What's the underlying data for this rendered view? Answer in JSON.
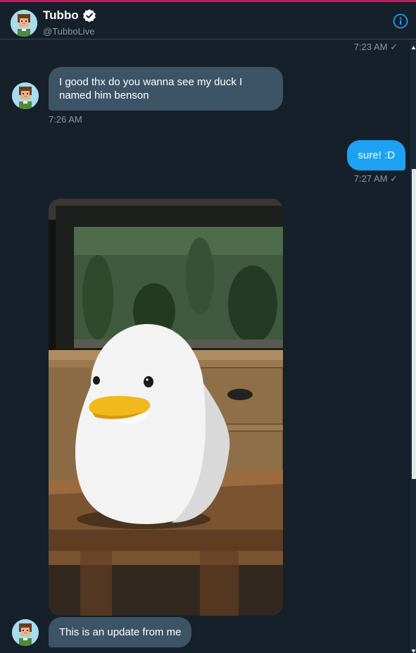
{
  "header": {
    "name": "Tubbo",
    "handle": "@TubboLive"
  },
  "messages": [
    {
      "type": "time",
      "side": "right",
      "text": "7:23 AM ✓"
    },
    {
      "type": "text",
      "side": "in",
      "text": "I good thx do you wanna see my duck I named him benson"
    },
    {
      "type": "time",
      "side": "left",
      "text": "7:26 AM"
    },
    {
      "type": "text",
      "side": "out",
      "text": "sure! :D"
    },
    {
      "type": "time",
      "side": "right",
      "text": "7:27 AM ✓"
    },
    {
      "type": "image",
      "side": "in",
      "subject": "white duck night light on wooden table"
    },
    {
      "type": "text",
      "side": "in",
      "text": "This is an update from me"
    }
  ],
  "colors": {
    "background": "#15202b",
    "incoming_bubble": "#3d5466",
    "outgoing_bubble": "#1da1f2",
    "secondary_text": "#8899a6",
    "accent": "#1da1f2"
  },
  "icons": [
    "verified-badge-icon",
    "info-icon",
    "check-icon"
  ]
}
